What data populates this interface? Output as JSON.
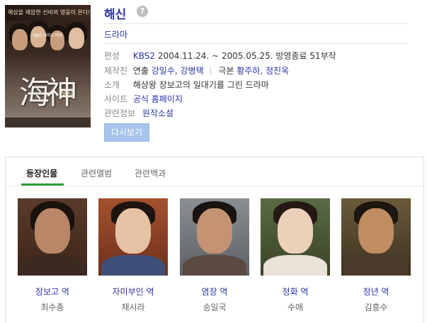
{
  "poster": {
    "tagline": "해상을 제압한 신비의 영웅이 온다!",
    "small_text": "KBS 대하드라마",
    "kanji": "海神",
    "sub": "해신"
  },
  "title": "해신",
  "help_icon": "?",
  "genre": "드라마",
  "info": {
    "broadcast_label": "편성",
    "channel": "KBS2",
    "broadcast_dates": "2004.11.24. ~ 2005.05.25. 방영종료 51부작",
    "production_label": "제작진",
    "director_prefix": "연출",
    "directors": "강일수, 강병택",
    "writer_prefix": "극본",
    "writers": "황주하, 정진옥",
    "intro_label": "소개",
    "intro_text": "해상왕 장보고의 일대기를 그린 드라마",
    "site_label": "사이트",
    "site_link": "공식 홈페이지",
    "related_label": "관련정보",
    "related_link": "원작소설"
  },
  "rewatch_button": "다시보기",
  "tabs": [
    {
      "label": "등장인물",
      "active": true
    },
    {
      "label": "관련앨범",
      "active": false
    },
    {
      "label": "관련백과",
      "active": false
    }
  ],
  "cast": [
    {
      "role": "장보고 역",
      "actor": "최수종"
    },
    {
      "role": "자미부인 역",
      "actor": "채시라"
    },
    {
      "role": "염장 역",
      "actor": "송일국"
    },
    {
      "role": "정화 역",
      "actor": "수애"
    },
    {
      "role": "정년 역",
      "actor": "김흥수"
    }
  ],
  "colors": {
    "link": "#2b35a0",
    "tab_accent": "#29a13a",
    "button_bg": "#a7c4ee"
  }
}
